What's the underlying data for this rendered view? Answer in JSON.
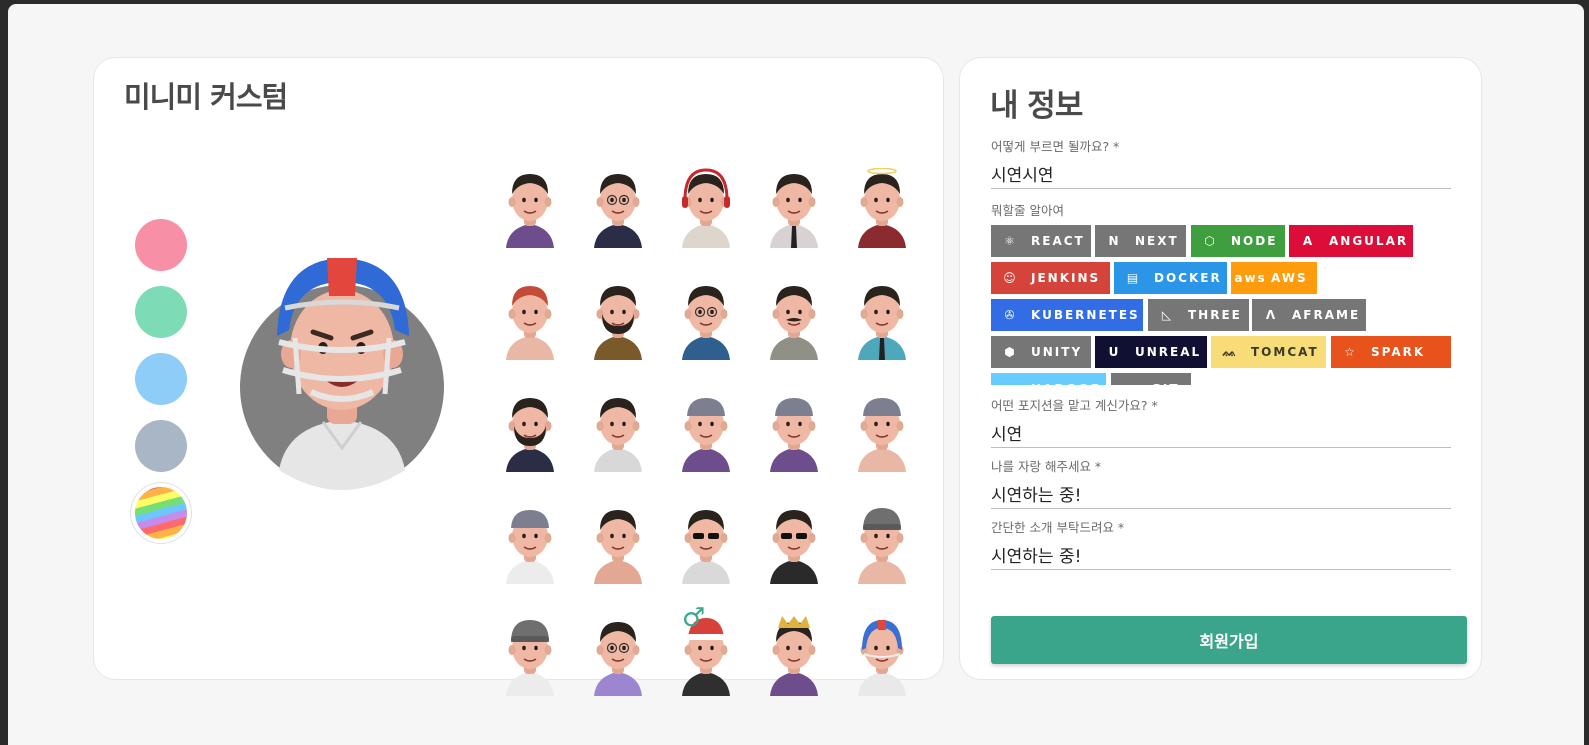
{
  "avatar_custom": {
    "title": "미니미 커스텀",
    "colors": [
      {
        "name": "pink",
        "hex": "#f78fa7"
      },
      {
        "name": "mint",
        "hex": "#7ddcb5"
      },
      {
        "name": "sky",
        "hex": "#8ecdf8"
      },
      {
        "name": "gray-blue",
        "hex": "#a8b6c6"
      },
      {
        "name": "rainbow",
        "hex": "rainbow"
      }
    ],
    "selected_background": "#808080",
    "avatars": [
      {
        "shirt": "#6e4d8c",
        "hair": "#2a221d",
        "acc": "none"
      },
      {
        "shirt": "#2a2d45",
        "hair": "#2a221d",
        "acc": "glasses"
      },
      {
        "shirt": "#ddd6cc",
        "hair": "#2a221d",
        "acc": "headphones"
      },
      {
        "shirt": "#d9d2d2",
        "hair": "#2a221d",
        "acc": "tie"
      },
      {
        "shirt": "#8c2b2f",
        "hair": "#2a221d",
        "acc": "halo"
      },
      {
        "shirt": "#e8b7a5",
        "hair": "#c44b38",
        "acc": "none"
      },
      {
        "shirt": "#7a5a2a",
        "hair": "#2a221d",
        "acc": "beard"
      },
      {
        "shirt": "#2f5f8e",
        "hair": "#2a221d",
        "acc": "glasses"
      },
      {
        "shirt": "#909086",
        "hair": "#2a221d",
        "acc": "mustache"
      },
      {
        "shirt": "#4ea8bc",
        "hair": "#2a221d",
        "acc": "tie"
      },
      {
        "shirt": "#2a2d45",
        "hair": "#2a221d",
        "acc": "beard"
      },
      {
        "shirt": "#d8d8d8",
        "hair": "#2a221d",
        "acc": "none"
      },
      {
        "shirt": "#6e4d8c",
        "hair": "#7c7f8f",
        "acc": "cap"
      },
      {
        "shirt": "#6e4d8c",
        "hair": "#7c7f8f",
        "acc": "cap"
      },
      {
        "shirt": "#e8b7a5",
        "hair": "#7c7f8f",
        "acc": "cap"
      },
      {
        "shirt": "#ececec",
        "hair": "#7c7f8f",
        "acc": "cap"
      },
      {
        "shirt": "#e3a893",
        "hair": "#2a221d",
        "acc": "none"
      },
      {
        "shirt": "#d9d9d9",
        "hair": "#2a221d",
        "acc": "sunglasses"
      },
      {
        "shirt": "#2a2a2a",
        "hair": "#2a221d",
        "acc": "sunglasses"
      },
      {
        "shirt": "#e8b7a5",
        "hair": "#6f6f6f",
        "acc": "beanie"
      },
      {
        "shirt": "#ececec",
        "hair": "#6f6f6f",
        "acc": "beanie"
      },
      {
        "shirt": "#9c86cf",
        "hair": "#2a221d",
        "acc": "glasses"
      },
      {
        "shirt": "#2f2f2f",
        "hair": "#d6423a",
        "acc": "santa"
      },
      {
        "shirt": "#6e4d8c",
        "hair": "#e2b240",
        "acc": "crown"
      },
      {
        "shirt": "#e9e9e9",
        "hair": "#3b6fd1",
        "acc": "helmet"
      }
    ],
    "gender_symbol": "♂"
  },
  "profile": {
    "title": "내 정보",
    "fields": {
      "nickname": {
        "label": "어떻게 부르면 될까요? *",
        "value": "시연시연"
      },
      "stack": {
        "label": "뭐할줄 알아여"
      },
      "position": {
        "label": "어떤 포지션을 맡고 계신가요? *",
        "value": "시연"
      },
      "brag": {
        "label": "나를 자랑 해주세요 *",
        "value": "시연하는 중!"
      },
      "intro": {
        "label": "간단한 소개 부탁드려요 *",
        "value": "시연하는 중!"
      }
    },
    "stacks": [
      {
        "label": "REACT",
        "color": "#767676",
        "icon": "⚛"
      },
      {
        "label": "NEXT",
        "color": "#767676",
        "icon": "N"
      },
      {
        "label": "NODE",
        "color": "#3f9f3f",
        "icon": "⬡"
      },
      {
        "label": "ANGULAR",
        "color": "#dc0e39",
        "icon": "A"
      },
      {
        "label": "JENKINS",
        "color": "#d5443a",
        "icon": "☺"
      },
      {
        "label": "DOCKER",
        "color": "#2b96e8",
        "icon": "▤"
      },
      {
        "label": "AWS",
        "color": "#ff9c0d",
        "icon": "aws"
      },
      {
        "label": "KUBERNETES",
        "color": "#326de6",
        "icon": "✇"
      },
      {
        "label": "THREE",
        "color": "#767676",
        "icon": "◺"
      },
      {
        "label": "AFRAME",
        "color": "#767676",
        "icon": "Λ"
      },
      {
        "label": "UNITY",
        "color": "#767676",
        "icon": "⬢"
      },
      {
        "label": "UNREAL",
        "color": "#101033",
        "icon": "U"
      },
      {
        "label": "TOMCAT",
        "color": "#f8dc78",
        "icon": "ᨐ"
      },
      {
        "label": "SPARK",
        "color": "#e8531b",
        "icon": "☆"
      },
      {
        "label": "HADOOP",
        "color": "#66ccff",
        "icon": "◆"
      },
      {
        "label": "GIT",
        "color": "#767676",
        "icon": "◈"
      }
    ],
    "submit_label": "회원가입"
  }
}
